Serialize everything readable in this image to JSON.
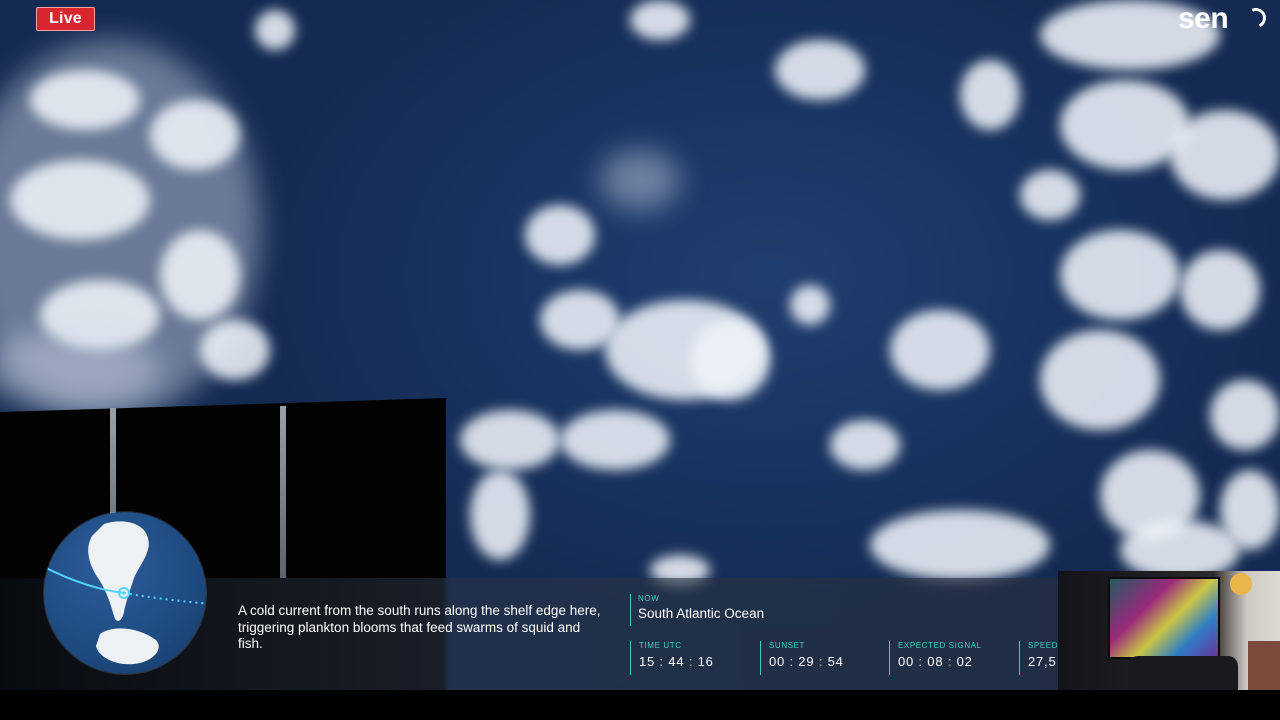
{
  "overlay": {
    "live_badge": "Live",
    "brand": "sen"
  },
  "info": {
    "fact_text": "A cold current from the south runs along the shelf edge here, triggering plankton blooms that feed swarms of squid and fish.",
    "now_label": "NOW",
    "now_value": "South Atlantic Ocean",
    "stats": [
      {
        "label": "TIME UTC",
        "value": "15 : 44 : 16"
      },
      {
        "label": "SUNSET",
        "value": "00 : 29 : 54"
      },
      {
        "label": "EXPECTED SIGNAL",
        "value": "00 : 08 : 02"
      },
      {
        "label": "SPEED",
        "value": "27,5"
      }
    ]
  },
  "colors": {
    "live_red": "#d8262f",
    "accent_teal": "#3fd3c0",
    "ocean": "#1a3563"
  },
  "icons": {
    "globe": "orbit-globe-icon",
    "logo": "sen-logo"
  }
}
